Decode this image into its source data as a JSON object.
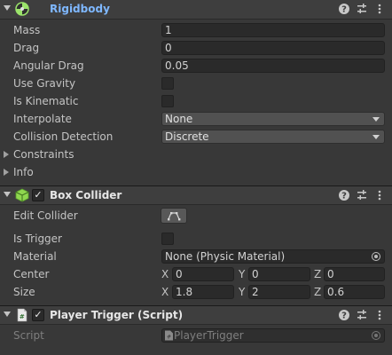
{
  "rigidbody": {
    "title": "Rigidbody",
    "title_color": "#7fb8ff",
    "mass_label": "Mass",
    "mass_value": "1",
    "drag_label": "Drag",
    "drag_value": "0",
    "angular_drag_label": "Angular Drag",
    "angular_drag_value": "0.05",
    "use_gravity_label": "Use Gravity",
    "use_gravity_checked": false,
    "is_kinematic_label": "Is Kinematic",
    "is_kinematic_checked": false,
    "interpolate_label": "Interpolate",
    "interpolate_value": "None",
    "collision_label": "Collision Detection",
    "collision_value": "Discrete",
    "constraints_label": "Constraints",
    "info_label": "Info"
  },
  "box_collider": {
    "title": "Box Collider",
    "enabled": true,
    "edit_collider_label": "Edit Collider",
    "is_trigger_label": "Is Trigger",
    "is_trigger_checked": false,
    "material_label": "Material",
    "material_value": "None (Physic Material)",
    "center_label": "Center",
    "center": {
      "x_label": "X",
      "x": "0",
      "y_label": "Y",
      "y": "0",
      "z_label": "Z",
      "z": "0"
    },
    "size_label": "Size",
    "size": {
      "x_label": "X",
      "x": "1.8",
      "y_label": "Y",
      "y": "2",
      "z_label": "Z",
      "z": "0.6"
    }
  },
  "player_trigger": {
    "title": "Player Trigger (Script)",
    "enabled": true,
    "script_label": "Script",
    "script_value": "PlayerTrigger"
  },
  "icons": [
    "help-icon",
    "presets-icon",
    "more-options-icon",
    "object-picker-icon",
    "edit-collider-icon",
    "script-asset-icon"
  ]
}
